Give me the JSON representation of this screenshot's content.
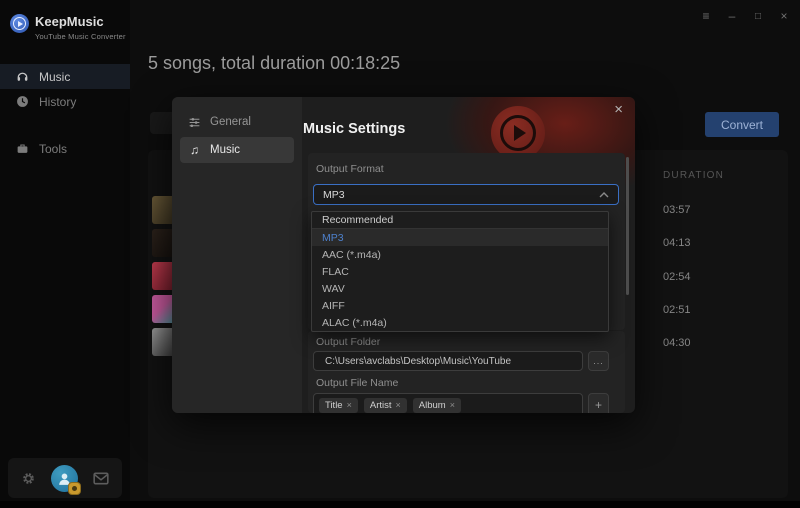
{
  "app": {
    "name": "KeepMusic",
    "tagline": "YouTube Music Converter"
  },
  "window_controls": {
    "menu": "≡",
    "minimize": "–",
    "maximize": "□",
    "close": "×"
  },
  "sidebar": {
    "items": [
      {
        "label": "Music",
        "active": true
      },
      {
        "label": "History",
        "active": false
      },
      {
        "label": "Tools",
        "active": false
      }
    ]
  },
  "header": {
    "summary": "5 songs, total duration 00:18:25",
    "convert_label": "Convert"
  },
  "song_list": {
    "duration_header": "DURATION",
    "durations": [
      "03:57",
      "04:13",
      "02:54",
      "02:51",
      "04:30"
    ]
  },
  "dialog": {
    "title": "Music Settings",
    "close_glyph": "×",
    "tabs": [
      {
        "label": "General",
        "active": false
      },
      {
        "label": "Music",
        "active": true
      }
    ],
    "music_tab_icon_glyph": "♫",
    "output_format": {
      "label": "Output Format",
      "value": "MP3"
    },
    "dropdown": {
      "header": "Recommended",
      "options": [
        "MP3",
        "AAC (*.m4a)",
        "FLAC",
        "WAV",
        "AIFF",
        "ALAC (*.m4a)"
      ],
      "selected": "MP3"
    },
    "output_folder": {
      "label": "Output Folder",
      "value": "C:\\Users\\avclabs\\Desktop\\Music\\YouTube",
      "browse_label": "..."
    },
    "output_file_name": {
      "label": "Output File Name",
      "tags": [
        "Title",
        "Artist",
        "Album"
      ],
      "remove_glyph": "×",
      "add_label": "+"
    }
  },
  "colors": {
    "accent_blue": "#3a6fc4",
    "selected_option_blue": "#4d80cc",
    "brand_red": "#8a2c22",
    "convert_button": "#24416f",
    "dialog_bg": "#1e1e1e"
  }
}
